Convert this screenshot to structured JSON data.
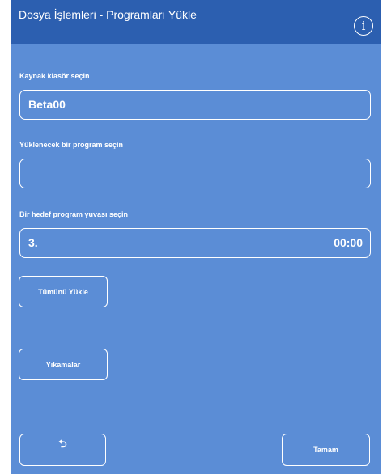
{
  "header": {
    "title": "Dosya İşlemleri - Programları Yükle",
    "info_icon": "info-icon",
    "info_glyph": "i"
  },
  "source_folder": {
    "label": "Kaynak klasör seçin",
    "value": "Beta00"
  },
  "program": {
    "label": "Yüklenecek bir program seçin",
    "value": ""
  },
  "target_slot": {
    "label": "Bir hedef program yuvası seçin",
    "slot": "3.",
    "time": "00:00"
  },
  "buttons": {
    "load_all": "Tümünü Yükle",
    "rinses": "Yıkamalar",
    "back_icon": "undo-arrow-icon",
    "back_glyph": "⮌",
    "ok": "Tamam"
  },
  "colors": {
    "background": "#5b8dd6",
    "header": "#2c5fb0",
    "text": "#ffffff"
  }
}
